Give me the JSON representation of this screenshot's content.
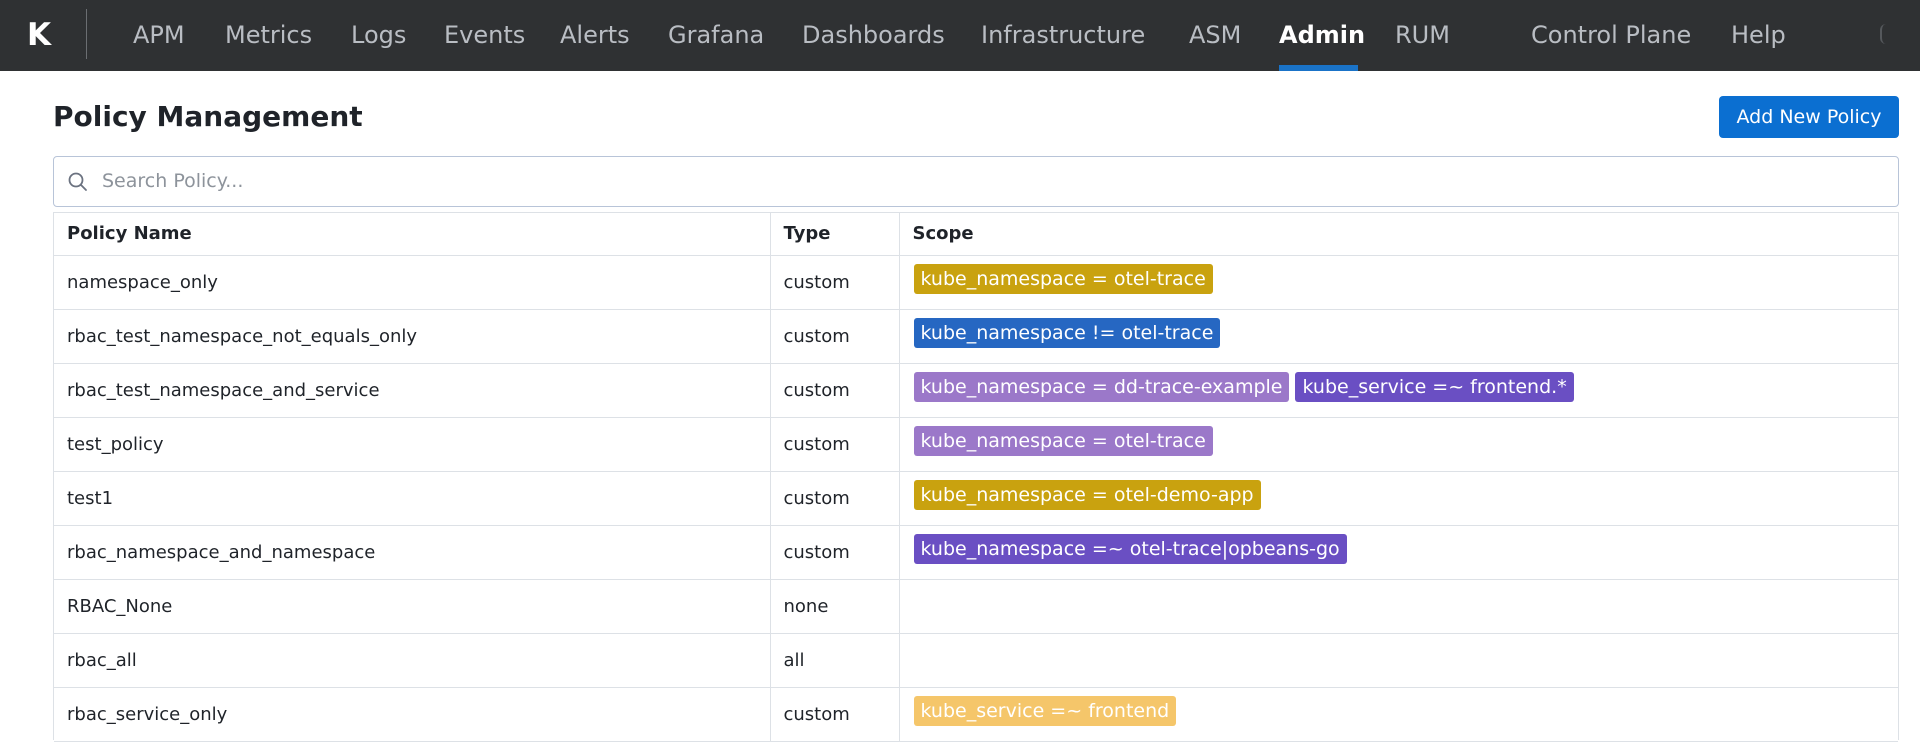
{
  "app": {
    "logo_letter": "K",
    "nav": [
      {
        "label": "APM",
        "active": false
      },
      {
        "label": "Metrics",
        "active": false
      },
      {
        "label": "Logs",
        "active": false
      },
      {
        "label": "Events",
        "active": false
      },
      {
        "label": "Alerts",
        "active": false
      },
      {
        "label": "Grafana",
        "active": false
      },
      {
        "label": "Dashboards",
        "active": false
      },
      {
        "label": "Infrastructure",
        "active": false
      },
      {
        "label": "ASM",
        "active": false
      },
      {
        "label": "Admin",
        "active": true
      },
      {
        "label": "RUM",
        "active": false
      },
      {
        "label": "Control Plane",
        "active": false
      },
      {
        "label": "Help",
        "active": false
      }
    ]
  },
  "page": {
    "title": "Policy Management",
    "add_button_label": "Add New Policy",
    "search": {
      "placeholder": "Search Policy...",
      "value": ""
    }
  },
  "table": {
    "headers": {
      "name": "Policy Name",
      "type": "Type",
      "scope": "Scope"
    },
    "rows": [
      {
        "name": "namespace_only",
        "type": "custom",
        "scope": [
          {
            "text": "kube_namespace = otel-trace",
            "color": "#c9a20f"
          }
        ]
      },
      {
        "name": "rbac_test_namespace_not_equals_only",
        "type": "custom",
        "scope": [
          {
            "text": "kube_namespace != otel-trace",
            "color": "#2667c2"
          }
        ]
      },
      {
        "name": "rbac_test_namespace_and_service",
        "type": "custom",
        "scope": [
          {
            "text": "kube_namespace = dd-trace-example",
            "color": "#9b78c9"
          },
          {
            "text": "kube_service =~ frontend.*",
            "color": "#6a4fc3"
          }
        ]
      },
      {
        "name": "test_policy",
        "type": "custom",
        "scope": [
          {
            "text": "kube_namespace = otel-trace",
            "color": "#9b78c9"
          }
        ]
      },
      {
        "name": "test1",
        "type": "custom",
        "scope": [
          {
            "text": "kube_namespace = otel-demo-app",
            "color": "#c9a20f"
          }
        ]
      },
      {
        "name": "rbac_namespace_and_namespace",
        "type": "custom",
        "scope": [
          {
            "text": "kube_namespace =~ otel-trace|opbeans-go",
            "color": "#6a4fc3"
          }
        ]
      },
      {
        "name": "RBAC_None",
        "type": "none",
        "scope": []
      },
      {
        "name": "rbac_all",
        "type": "all",
        "scope": []
      },
      {
        "name": "rbac_service_only",
        "type": "custom",
        "scope": [
          {
            "text": "kube_service =~ frontend",
            "color": "#f5c66a"
          }
        ]
      }
    ]
  }
}
